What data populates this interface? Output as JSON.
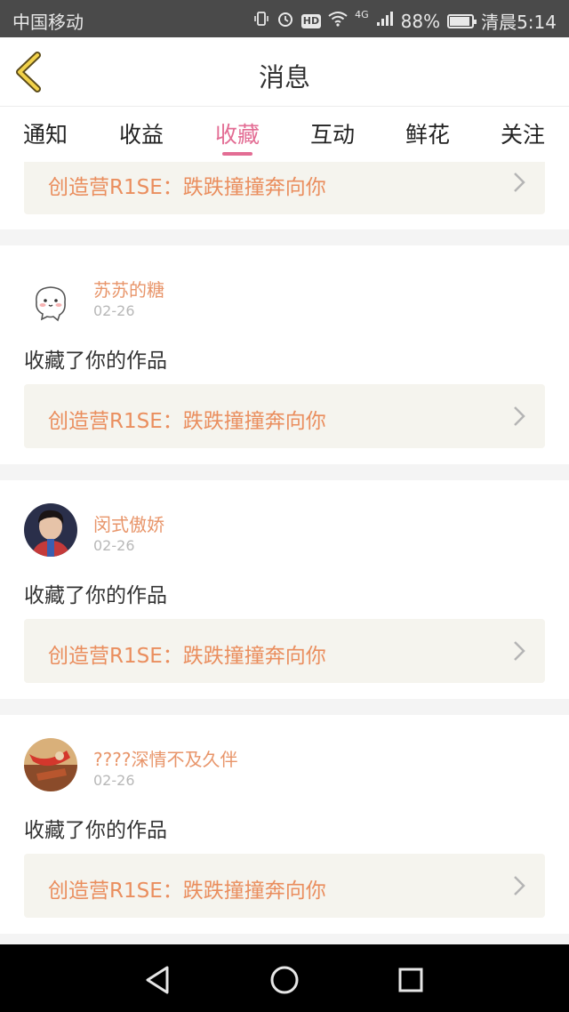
{
  "status_bar": {
    "carrier": "中国移动",
    "network": "4G",
    "hd": "HD",
    "battery": "88%",
    "time": "清晨5:14",
    "battery_level": 0.88
  },
  "header": {
    "title": "消息",
    "back_icon": "back-chevron-icon"
  },
  "tabs": [
    {
      "label": "通知",
      "active": false
    },
    {
      "label": "收益",
      "active": false
    },
    {
      "label": "收藏",
      "active": true
    },
    {
      "label": "互动",
      "active": false
    },
    {
      "label": "鲜花",
      "active": false
    },
    {
      "label": "关注",
      "active": false
    }
  ],
  "accent_color": "#e36d94",
  "link_color": "#ea8e5e",
  "notifications": [
    {
      "work_title": "创造营R1SE：跌跌撞撞奔向你"
    },
    {
      "user": "苏苏的糖",
      "date": "02-26",
      "action": "收藏了你的作品",
      "work_title": "创造营R1SE：跌跌撞撞奔向你"
    },
    {
      "user": "闵式傲娇",
      "date": "02-26",
      "action": "收藏了你的作品",
      "work_title": "创造营R1SE：跌跌撞撞奔向你"
    },
    {
      "user": "????深情不及久伴",
      "date": "02-26",
      "action": "收藏了你的作品",
      "work_title": "创造营R1SE：跌跌撞撞奔向你"
    }
  ],
  "nav_bar": {
    "back": "nav-back-icon",
    "home": "nav-home-icon",
    "recents": "nav-recents-icon"
  }
}
